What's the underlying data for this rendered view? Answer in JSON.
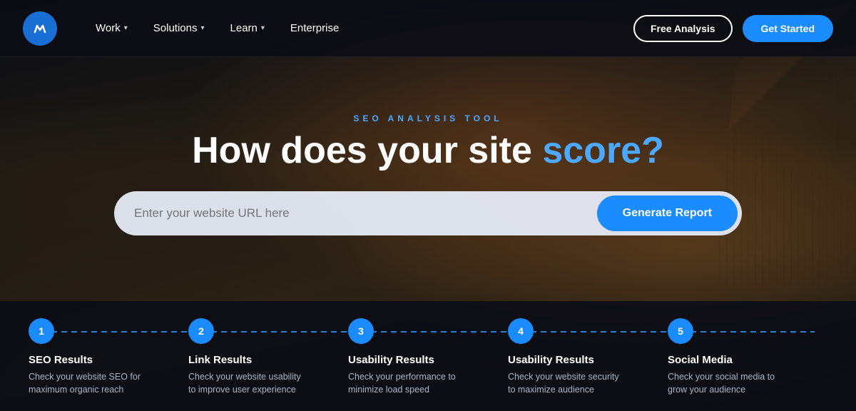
{
  "brand": {
    "logo_alt": "Moz logo"
  },
  "navbar": {
    "links": [
      {
        "label": "Work",
        "has_chevron": true
      },
      {
        "label": "Solutions",
        "has_chevron": true
      },
      {
        "label": "Learn",
        "has_chevron": true
      },
      {
        "label": "Enterprise",
        "has_chevron": false
      }
    ],
    "free_analysis_label": "Free Analysis",
    "get_started_label": "Get Started"
  },
  "hero": {
    "tool_label": "SEO ANALYSIS TOOL",
    "title_part1": "How does your site ",
    "title_accent": "score?",
    "search_placeholder": "Enter your website URL here",
    "generate_btn_label": "Generate Report"
  },
  "steps": [
    {
      "number": "1",
      "title": "SEO Results",
      "desc": "Check your website SEO for maximum organic reach"
    },
    {
      "number": "2",
      "title": "Link Results",
      "desc": "Check your website usability to improve user experience"
    },
    {
      "number": "3",
      "title": "Usability Results",
      "desc": "Check your performance to minimize load speed"
    },
    {
      "number": "4",
      "title": "Usability Results",
      "desc": "Check your website security to maximize audience"
    },
    {
      "number": "5",
      "title": "Social Media",
      "desc": "Check your social media to grow your audience"
    }
  ]
}
